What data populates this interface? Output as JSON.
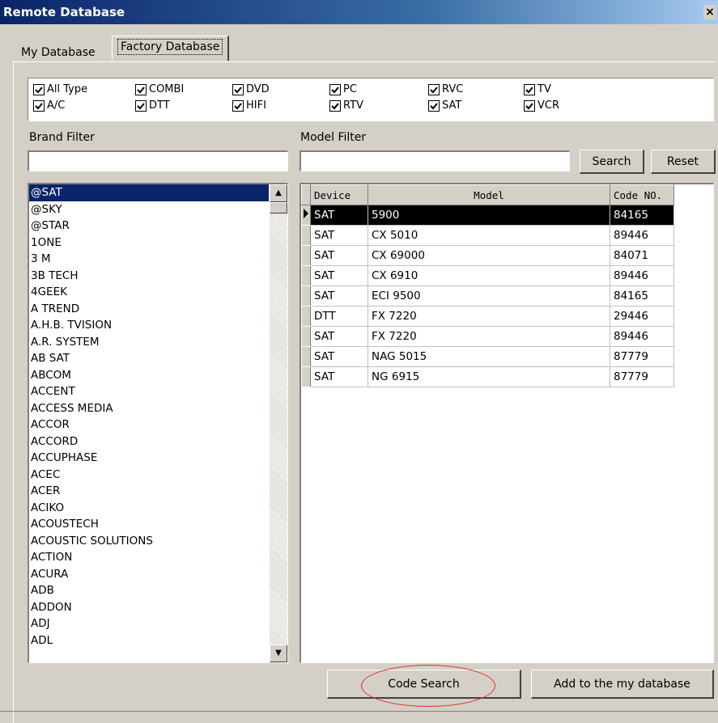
{
  "window": {
    "title": "Remote Database"
  },
  "tabs": [
    {
      "label": "My Database",
      "active": false
    },
    {
      "label": "Factory Database",
      "active": true
    }
  ],
  "device_types": [
    {
      "label": "All Type",
      "checked": true
    },
    {
      "label": "COMBI",
      "checked": true
    },
    {
      "label": "DVD",
      "checked": true
    },
    {
      "label": "PC",
      "checked": true
    },
    {
      "label": "RVC",
      "checked": true
    },
    {
      "label": "TV",
      "checked": true
    },
    {
      "label": "A/C",
      "checked": true
    },
    {
      "label": "DTT",
      "checked": true
    },
    {
      "label": "HIFI",
      "checked": true
    },
    {
      "label": "RTV",
      "checked": true
    },
    {
      "label": "SAT",
      "checked": true
    },
    {
      "label": "VCR",
      "checked": true
    }
  ],
  "brand_filter": {
    "label": "Brand Filter",
    "value": ""
  },
  "model_filter": {
    "label": "Model Filter",
    "value": ""
  },
  "buttons": {
    "search": "Search",
    "reset": "Reset",
    "code_search": "Code Search",
    "add_to_db": "Add to the my database"
  },
  "brands": [
    "@SAT",
    "@SKY",
    "@STAR",
    "1ONE",
    "3 M",
    "3B TECH",
    "4GEEK",
    "A TREND",
    "A.H.B. TVISION",
    "A.R. SYSTEM",
    "AB SAT",
    "ABCOM",
    "ACCENT",
    "ACCESS MEDIA",
    "ACCOR",
    "ACCORD",
    "ACCUPHASE",
    "ACEC",
    "ACER",
    "ACIKO",
    "ACOUSTECH",
    "ACOUSTIC SOLUTIONS",
    "ACTION",
    "ACURA",
    "ADB",
    "ADDON",
    "ADJ",
    "ADL"
  ],
  "selected_brand": "@SAT",
  "grid": {
    "columns": [
      "Device",
      "Model",
      "Code NO."
    ],
    "rows": [
      [
        "SAT",
        "5900",
        "84165"
      ],
      [
        "SAT",
        "CX 5010",
        "89446"
      ],
      [
        "SAT",
        "CX 69000",
        "84071"
      ],
      [
        "SAT",
        "CX 6910",
        "89446"
      ],
      [
        "SAT",
        "ECI 9500",
        "84165"
      ],
      [
        "DTT",
        "FX 7220",
        "29446"
      ],
      [
        "SAT",
        "FX 7220",
        "89446"
      ],
      [
        "SAT",
        "NAG 5015",
        "87779"
      ],
      [
        "SAT",
        "NG 6915",
        "87779"
      ]
    ],
    "selected_row": 0
  },
  "colors": {
    "selection": "#0a246a",
    "title_bar": "#0a246a",
    "annotation": "#e03030"
  },
  "icons": {
    "close": "close-icon",
    "checkbox": "checkmark-icon",
    "scroll_up": "scroll-up-arrow-icon",
    "scroll_down": "scroll-down-arrow-icon",
    "row_pointer": "row-pointer-icon"
  }
}
